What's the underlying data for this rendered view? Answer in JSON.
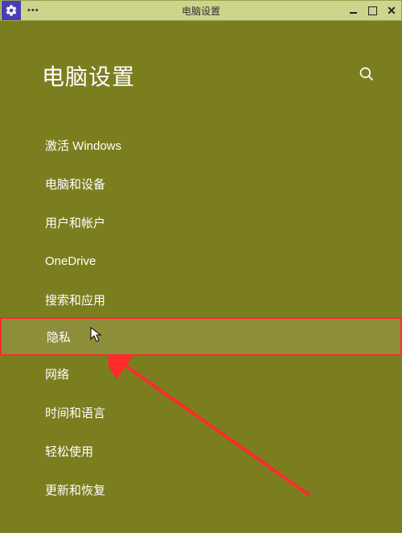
{
  "titlebar": {
    "title": "电脑设置",
    "dots": "•••"
  },
  "header": {
    "title": "电脑设置"
  },
  "menu": {
    "items": [
      {
        "label": "激活 Windows"
      },
      {
        "label": "电脑和设备"
      },
      {
        "label": "用户和帐户"
      },
      {
        "label": "OneDrive"
      },
      {
        "label": "搜索和应用"
      },
      {
        "label": "隐私"
      },
      {
        "label": "网络"
      },
      {
        "label": "时间和语言"
      },
      {
        "label": "轻松使用"
      },
      {
        "label": "更新和恢复"
      }
    ]
  },
  "highlighted_index": 5
}
